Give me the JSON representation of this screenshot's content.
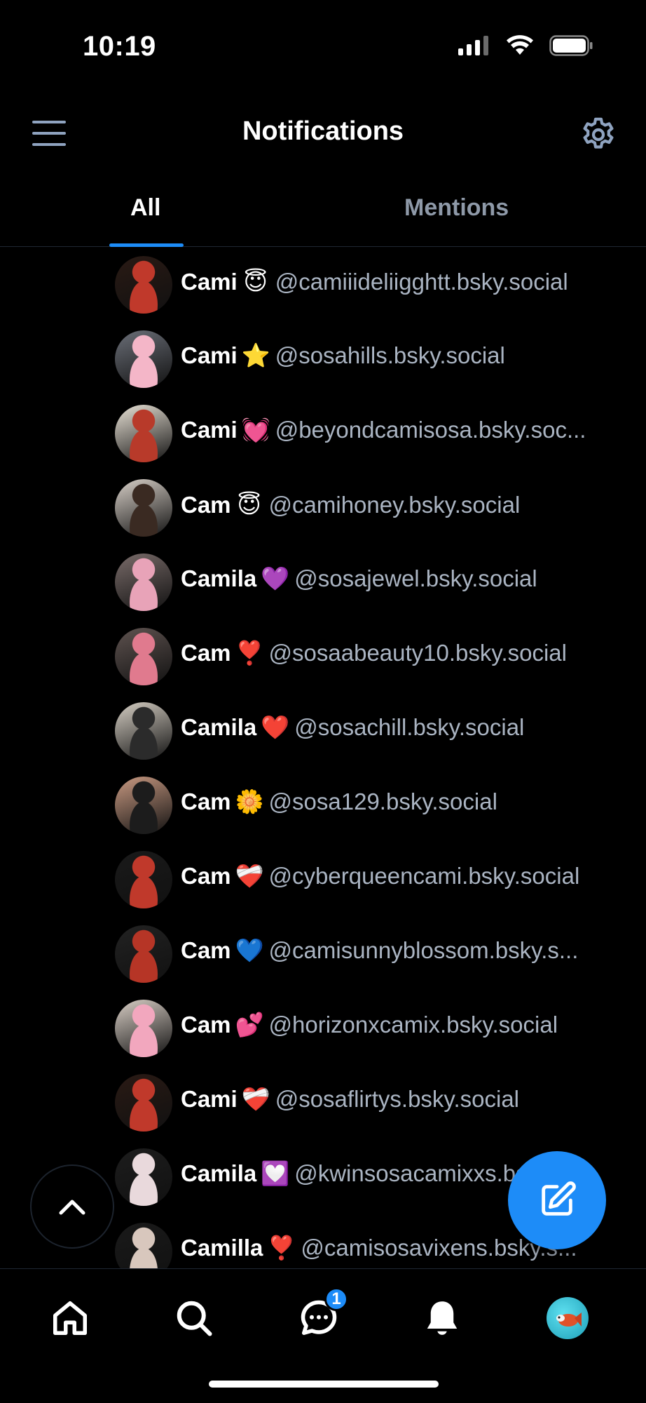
{
  "status_bar": {
    "time": "10:19"
  },
  "header": {
    "title": "Notifications"
  },
  "tabs": [
    {
      "label": "All",
      "active": true
    },
    {
      "label": "Mentions",
      "active": false
    }
  ],
  "notifications": [
    {
      "name": "Cami",
      "emoji": "😇",
      "handle": "@camiiideliigghtt.bsky.social",
      "avatar_colors": [
        "#c0392b",
        "#2a1a14"
      ]
    },
    {
      "name": "Cami",
      "emoji": "⭐",
      "handle": "@sosahills.bsky.social",
      "avatar_colors": [
        "#f4b6c8",
        "#6b6f78"
      ]
    },
    {
      "name": "Cami",
      "emoji": "💓",
      "handle": "@beyondcamisosa.bsky.soc...",
      "avatar_colors": [
        "#b83a2a",
        "#e9e2d6"
      ]
    },
    {
      "name": "Cam",
      "emoji": "😇",
      "handle": "@camihoney.bsky.social",
      "avatar_colors": [
        "#3a2a22",
        "#d8d0c8"
      ]
    },
    {
      "name": "Camila",
      "emoji": "💜",
      "handle": "@sosajewel.bsky.social",
      "avatar_colors": [
        "#e8a3b8",
        "#7a6c6a"
      ]
    },
    {
      "name": "Cam",
      "emoji": "❣️",
      "handle": "@sosaabeauty10.bsky.social",
      "avatar_colors": [
        "#e07a8e",
        "#5f5350"
      ]
    },
    {
      "name": "Camila",
      "emoji": "❤️",
      "handle": "@sosachill.bsky.social",
      "avatar_colors": [
        "#2b2b2b",
        "#d6cfc4"
      ]
    },
    {
      "name": "Cam",
      "emoji": "🌼",
      "handle": "@sosa129.bsky.social",
      "avatar_colors": [
        "#1c1c1c",
        "#c99a82"
      ]
    },
    {
      "name": "Cam",
      "emoji": "❤️‍🩹",
      "handle": "@cyberqueencami.bsky.social",
      "avatar_colors": [
        "#c0392b",
        "#1a1a1a"
      ]
    },
    {
      "name": "Cam",
      "emoji": "💙",
      "handle": "@camisunnyblossom.bsky.s...",
      "avatar_colors": [
        "#b63526",
        "#222222"
      ]
    },
    {
      "name": "Cam",
      "emoji": "💕",
      "handle": "@horizonxcamix.bsky.social",
      "avatar_colors": [
        "#f2a7be",
        "#d9cfc6"
      ]
    },
    {
      "name": "Cami",
      "emoji": "❤️‍🩹",
      "handle": "@sosaflirtys.bsky.social",
      "avatar_colors": [
        "#c0392b",
        "#2a1a14"
      ]
    },
    {
      "name": "Camila",
      "emoji": "💟",
      "handle": "@kwinsosacamixxs.bsky.s...",
      "avatar_colors": [
        "#e9d9dc",
        "#1d1d1d"
      ]
    },
    {
      "name": "Camilla",
      "emoji": "❣️",
      "handle": "@camisosavixens.bsky.s...",
      "avatar_colors": [
        "#d8c7bd",
        "#1a1a1a"
      ]
    }
  ],
  "bottom_nav": {
    "items": [
      "home-icon",
      "search-icon",
      "chat-icon",
      "bell-icon",
      "profile-avatar"
    ],
    "chat_badge": "1"
  },
  "colors": {
    "accent": "#1d8cf8",
    "background": "#000000",
    "handle_text": "#aab4c2",
    "inactive_tab": "#8e99a8"
  }
}
